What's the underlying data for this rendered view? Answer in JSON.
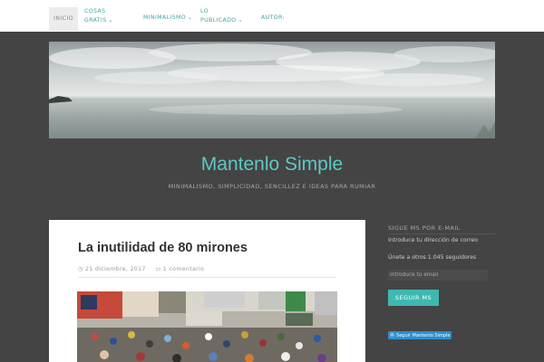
{
  "nav": {
    "home": "Inicio",
    "cosas_line1": "Cosas",
    "cosas_line2": "gratis",
    "minimalismo": "Minimalismo",
    "lo_line1": "Lo",
    "lo_line2": "publicado",
    "autor": "Autor:"
  },
  "site": {
    "title": "Mantenlo Simple",
    "description": "Minimalismo, simplicidad, sencillez e ideas para rumiar"
  },
  "post": {
    "title": "La inutilidad de 80 mirones",
    "date": "21 diciembre, 2017",
    "comments": "1 comentario"
  },
  "sidebar": {
    "widget_title": "Sigue MS por e-mail",
    "intro": "Introduce tu dirección de correo",
    "followers": "Únete a otros 1.045 seguidores",
    "email_placeholder": "Introduce tu email",
    "follow_button": "Seguir MS",
    "follow_badge": "Seguir Mantenlo Simple"
  },
  "icons": {
    "chevron": "chevron-down-icon",
    "clock": "clock-icon",
    "comment": "comment-icon",
    "badge": "wordpress-icon"
  },
  "colors": {
    "accent": "#3fb8b2",
    "title": "#5fc8c3",
    "background": "#444444"
  }
}
